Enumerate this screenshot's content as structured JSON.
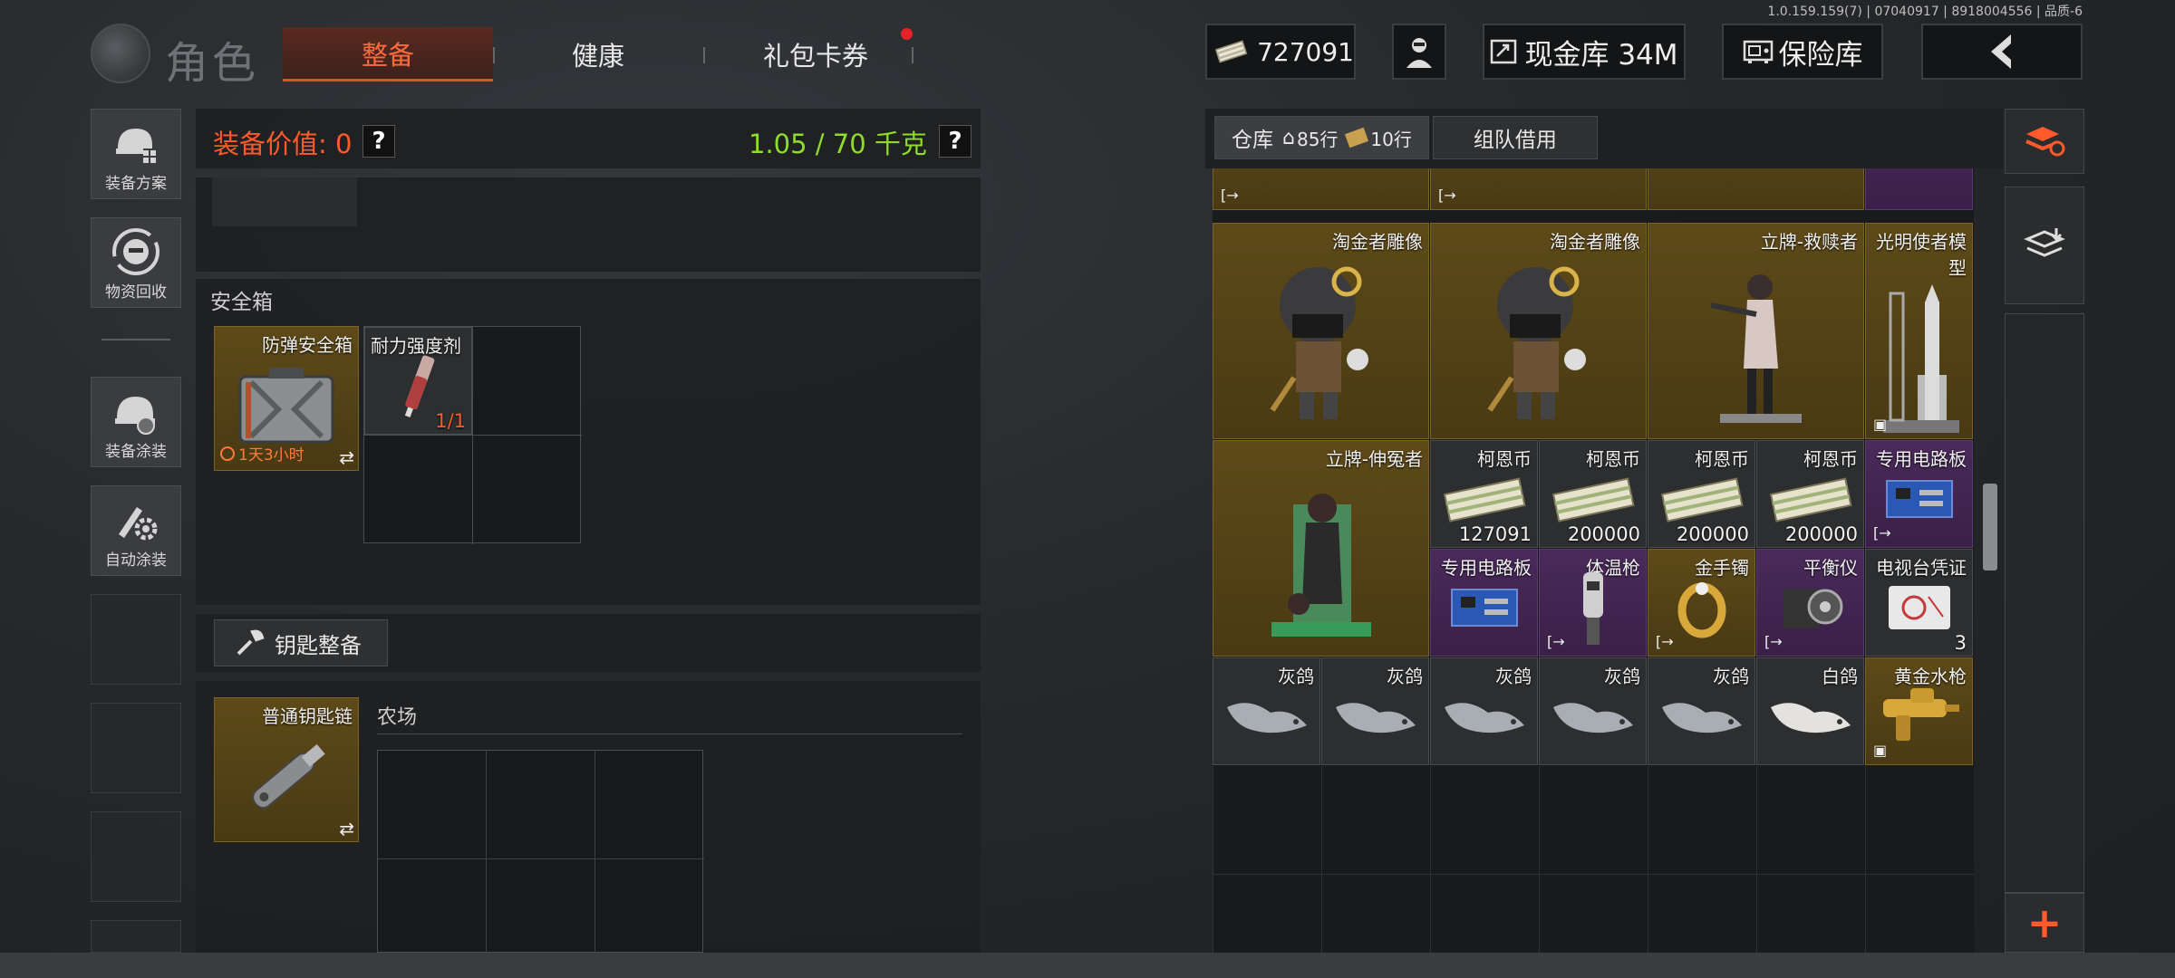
{
  "version": "1.0.159.159(7) | 07040917 | 8918004556 | 品质-6",
  "header": {
    "title": "角色",
    "tabs": [
      {
        "label": "整备",
        "active": true
      },
      {
        "label": "健康",
        "active": false
      },
      {
        "label": "礼包卡券",
        "active": false,
        "notification": true
      }
    ],
    "currency": "727091",
    "cash_vault": "现金库 34M",
    "insurance_vault": "保险库",
    "back_icon": "chevron-left-icon"
  },
  "sidebar": {
    "items": [
      {
        "label": "装备方案",
        "icon": "helmet-grid-icon"
      },
      {
        "label": "物资回收",
        "icon": "recycle-face-icon"
      },
      {
        "label": "装备涂装",
        "icon": "helmet-paint-icon"
      },
      {
        "label": "自动涂装",
        "icon": "brush-gear-icon"
      }
    ]
  },
  "loadout": {
    "value_label": "装备价值: 0",
    "help": "?",
    "weight": "1.05 / 70 千克",
    "safe_box": {
      "title": "安全箱",
      "container": {
        "name": "防弹安全箱",
        "timer": "1天3小时"
      },
      "item": {
        "name": "耐力强度剂",
        "count": "1/1"
      }
    },
    "keys": {
      "button": "钥匙整备",
      "chain": "普通钥匙链",
      "map_label": "农场"
    }
  },
  "warehouse": {
    "tabs": [
      {
        "label": "仓库",
        "sub_a": "85行",
        "sub_b": "10行"
      },
      {
        "label": "组队借用"
      }
    ],
    "items": [
      {
        "name": "淘金者雕像",
        "tone": "gold"
      },
      {
        "name": "淘金者雕像",
        "tone": "gold"
      },
      {
        "name": "立牌-救赎者",
        "tone": "gold"
      },
      {
        "name": "光明使者模型",
        "tone": "gold"
      },
      {
        "name": "立牌-伸冤者",
        "tone": "gold"
      },
      {
        "name": "柯恩币",
        "count": "127091",
        "tone": "dark"
      },
      {
        "name": "柯恩币",
        "count": "200000",
        "tone": "dark"
      },
      {
        "name": "柯恩币",
        "count": "200000",
        "tone": "dark"
      },
      {
        "name": "柯恩币",
        "count": "200000",
        "tone": "dark"
      },
      {
        "name": "专用电路板",
        "tone": "purple"
      },
      {
        "name": "专用电路板",
        "tone": "purple"
      },
      {
        "name": "体温枪",
        "tone": "purple"
      },
      {
        "name": "金手镯",
        "tone": "gold"
      },
      {
        "name": "平衡仪",
        "tone": "purple"
      },
      {
        "name": "电视台凭证",
        "count": "3",
        "tone": "dark"
      },
      {
        "name": "灰鸽",
        "tone": "dark"
      },
      {
        "name": "灰鸽",
        "tone": "dark"
      },
      {
        "name": "灰鸽",
        "tone": "dark"
      },
      {
        "name": "灰鸽",
        "tone": "dark"
      },
      {
        "name": "灰鸽",
        "tone": "dark"
      },
      {
        "name": "白鸽",
        "tone": "dark"
      },
      {
        "name": "黄金水枪",
        "tone": "gold"
      }
    ]
  },
  "colors": {
    "accent": "#ff5a2c",
    "weight": "#8fdc2a",
    "gold_item": "#5e4a18",
    "purple_item": "#4a2a5a"
  }
}
